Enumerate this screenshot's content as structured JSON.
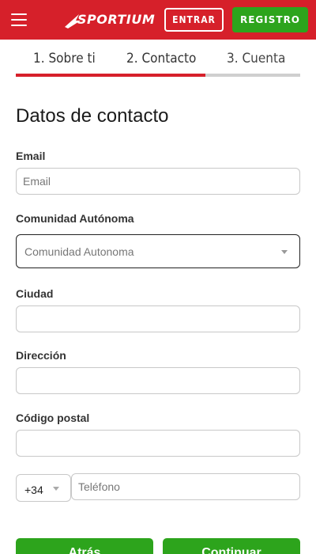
{
  "header": {
    "brand": "SPORTIUM",
    "login_label": "ENTRAR",
    "register_label": "REGISTRO",
    "brand_color": "#d6202a",
    "accent_green": "#2da41c"
  },
  "steps": {
    "items": [
      {
        "label": "1. Sobre ti"
      },
      {
        "label": "2. Contacto"
      },
      {
        "label": "3. Cuenta"
      }
    ],
    "current": 2,
    "progress_fraction": 0.667
  },
  "form": {
    "title": "Datos de contacto",
    "email": {
      "label": "Email",
      "placeholder": "Email",
      "value": ""
    },
    "region": {
      "label": "Comunidad Autónoma",
      "selected": "Comunidad Autonoma"
    },
    "city": {
      "label": "Ciudad",
      "value": ""
    },
    "address": {
      "label": "Dirección",
      "value": ""
    },
    "postal_code": {
      "label": "Código postal",
      "value": ""
    },
    "phone": {
      "prefix": "+34",
      "placeholder": "Teléfono",
      "value": ""
    }
  },
  "actions": {
    "back_label": "Atrás",
    "next_label": "Continuar"
  }
}
